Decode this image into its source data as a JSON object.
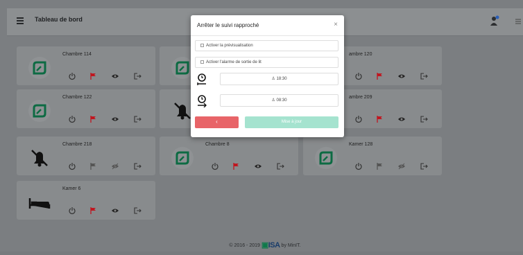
{
  "header": {
    "title": "Tableau de bord"
  },
  "rooms": [
    {
      "name": "Chambre 114",
      "icon": "leaf-icon",
      "flag": "red",
      "eye": "on"
    },
    {
      "name": "",
      "icon": "leaf-icon",
      "flag": "",
      "eye": ""
    },
    {
      "name": "ambre 120",
      "icon": "leaf-icon",
      "flag": "red",
      "eye": "on"
    },
    {
      "name": "Chambre 122",
      "icon": "leaf-icon",
      "flag": "red",
      "eye": "on"
    },
    {
      "name": "",
      "icon": "bell-off-icon",
      "flag": "",
      "eye": ""
    },
    {
      "name": "ambre 209",
      "icon": "leaf-icon",
      "flag": "red",
      "eye": "on"
    },
    {
      "name": "Chambre 218",
      "icon": "bell-off-icon",
      "flag": "grey",
      "eye": "off"
    },
    {
      "name": "Chambre 8",
      "icon": "leaf-icon",
      "flag": "red",
      "eye": "on"
    },
    {
      "name": "Kamer 128",
      "icon": "leaf-icon",
      "flag": "grey",
      "eye": "off"
    },
    {
      "name": "Kamer 6",
      "icon": "bed-icon",
      "flag": "red",
      "eye": "on"
    }
  ],
  "modal": {
    "title": "Arrêter le suivi rapproché",
    "close": "×",
    "preview_label": "Activer la prévisualisation",
    "bed_exit_label": "Activer l'alarme de sortie de lit",
    "time_from": "18:30",
    "time_to": "08:30",
    "cancel_label": "‹",
    "update_label": "Mise à jour"
  },
  "footer": {
    "text": "© 2016 - 2019",
    "logo": "ISA",
    "by": "by MinIT."
  },
  "colors": {
    "accent_green": "#0e7a4a",
    "flag_red": "#c0161f",
    "cancel": "#e86468",
    "update": "#a5e3cf"
  }
}
